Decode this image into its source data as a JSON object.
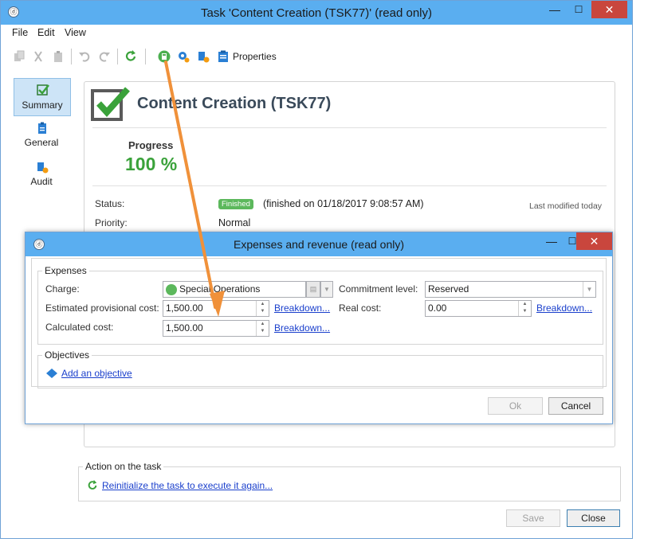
{
  "window": {
    "title": "Task 'Content Creation (TSK77)' (read only)",
    "app_icon": "app-icon",
    "minimize_glyph": "—",
    "maximize_glyph": "☐",
    "close_glyph": "✕"
  },
  "menu": [
    "File",
    "Edit",
    "View"
  ],
  "toolbar": {
    "properties_label": "Properties"
  },
  "nav": [
    {
      "label": "Summary",
      "icon": "check-icon",
      "selected": true
    },
    {
      "label": "General",
      "icon": "clipboard-icon",
      "selected": false
    },
    {
      "label": "Audit",
      "icon": "audit-icon",
      "selected": false
    }
  ],
  "summary": {
    "title": "Content Creation (TSK77)",
    "progress_label": "Progress",
    "progress_value": "100 %",
    "status_label": "Status:",
    "status_badge": "Finished",
    "status_text": "(finished on 01/18/2017 9:08:57 AM)",
    "last_modified": "Last modified today",
    "priority_label": "Priority:",
    "priority_value": "Normal"
  },
  "action": {
    "legend": "Action on the task",
    "link": "Reinitialize the task to execute it again..."
  },
  "footer": {
    "save": "Save",
    "close": "Close"
  },
  "dialog": {
    "title": "Expenses and revenue (read only)",
    "expenses_legend": "Expenses",
    "charge_label": "Charge:",
    "charge_value": "Special Operations",
    "commitment_label": "Commitment level:",
    "commitment_value": "Reserved",
    "est_label": "Estimated provisional cost:",
    "est_value": "1,500.00",
    "breakdown": "Breakdown...",
    "real_label": "Real cost:",
    "real_value": "0.00",
    "calc_label": "Calculated cost:",
    "calc_value": "1,500.00",
    "objectives_legend": "Objectives",
    "add_objective": "Add an objective",
    "ok": "Ok",
    "cancel": "Cancel"
  },
  "colors": {
    "title_bar": "#5aaef0",
    "close_red": "#c9463d",
    "progress_green": "#3aa23a",
    "link_blue": "#1a3fcc",
    "arrow_orange": "#f0913a"
  }
}
